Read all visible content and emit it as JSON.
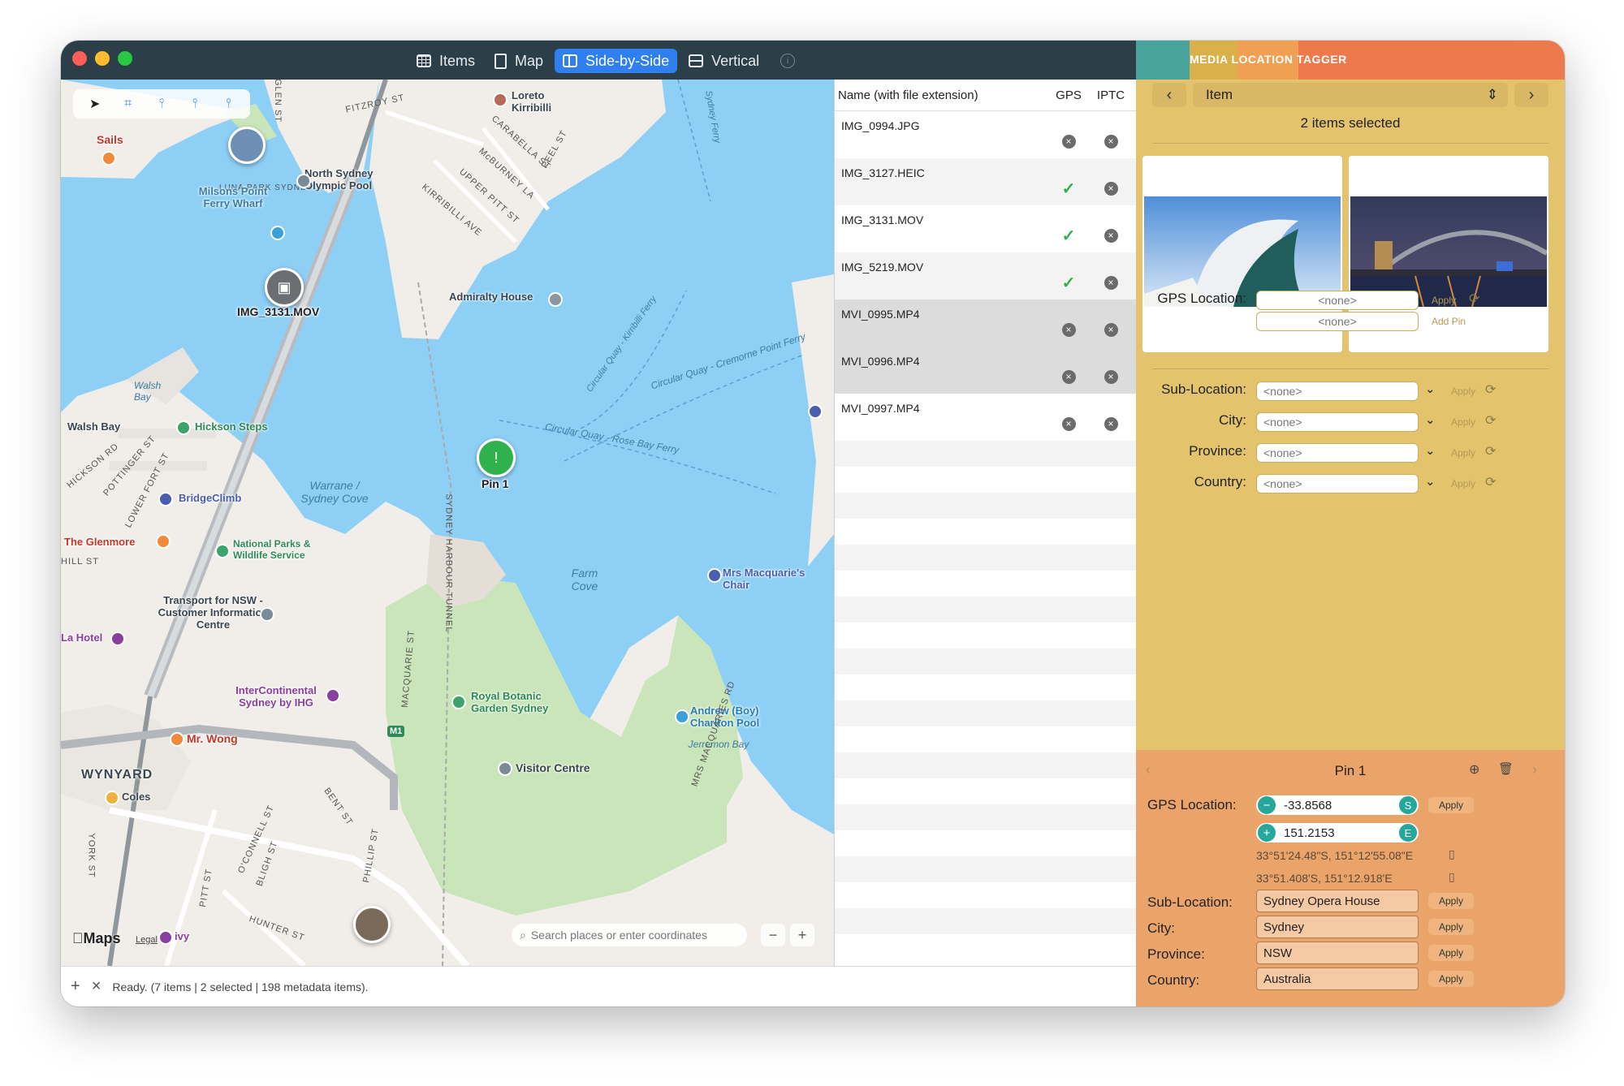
{
  "titlebar": {
    "segments": [
      {
        "label": "Items",
        "icon": "table-icon"
      },
      {
        "label": "Map",
        "icon": "document-icon"
      },
      {
        "label": "Side-by-Side",
        "icon": "split-columns-icon"
      },
      {
        "label": "Vertical",
        "icon": "split-rows-icon"
      }
    ],
    "active_segment": "Side-by-Side",
    "info_glyph": "i"
  },
  "map": {
    "labels": [
      "Sails",
      "LUNA PARK SYDNEY",
      "Milsons Point Ferry Wharf",
      "North Sydney Olympic Pool",
      "Loreto Kirribilli",
      "Admiralty House",
      "IMG_3131.MOV",
      "Walsh Bay",
      "Hickson Steps",
      "BridgeClimb",
      "The Glenmore",
      "National Parks & Wildlife Service",
      "Warrane / Sydney Cove",
      "Pin 1",
      "Farm Cove",
      "Mrs Macquarie's Chair",
      "Transport for NSW - Customer Information Centre",
      "La Hotel",
      "InterContinental Sydney by IHG",
      "Royal Botanic Garden Sydney",
      "Andrew (Boy) Charlton Pool",
      "Mr. Wong",
      "WYNYARD",
      "Coles",
      "Visitor Centre",
      "Jerremon Bay",
      "Circular Quay - Rose Bay Ferry",
      "Circular Quay - Cremorne Point Ferry",
      "Circular Quay - Kirribilli Ferry",
      "Sydney Ferry",
      "SYDNEY HARBOUR TUNNEL",
      "M1",
      "FITZROY ST",
      "CARABELLA ST",
      "McBURNEY LA",
      "UPPER PITT ST",
      "KIRRIBILLI AVE",
      "PEEL ST",
      "HICKSON RD",
      "LOWER FORT ST",
      "POTTINGER ST",
      "MACQUARIE ST",
      "MRS MACQUARIES RD",
      "YORK ST",
      "PHILLIP ST",
      "BENT ST",
      "BLIGH ST",
      "O'CONNELL ST",
      "PITT ST",
      "HUNTER ST",
      "GLEN ST",
      "HILL ST",
      "ivy"
    ],
    "markers": {
      "video": "IMG_3131.MOV",
      "pin": "Pin 1"
    },
    "search_placeholder": "Search places or enter coordinates",
    "attribution": "Maps",
    "legal": "Legal",
    "zoom_out": "−",
    "zoom_in": "+"
  },
  "list": {
    "headers": {
      "name": "Name (with file extension)",
      "gps": "GPS",
      "iptc": "IPTC"
    },
    "rows": [
      {
        "name": "IMG_0994.JPG",
        "gps": false,
        "iptc": false,
        "selected": false
      },
      {
        "name": "IMG_3127.HEIC",
        "gps": true,
        "iptc": false,
        "selected": false
      },
      {
        "name": "IMG_3131.MOV",
        "gps": true,
        "iptc": false,
        "selected": false
      },
      {
        "name": "IMG_5219.MOV",
        "gps": true,
        "iptc": false,
        "selected": false
      },
      {
        "name": "MVI_0995.MP4",
        "gps": false,
        "iptc": false,
        "selected": true
      },
      {
        "name": "MVI_0996.MP4",
        "gps": false,
        "iptc": false,
        "selected": true
      },
      {
        "name": "MVI_0997.MP4",
        "gps": false,
        "iptc": false,
        "selected": false
      }
    ]
  },
  "status": {
    "add": "+",
    "remove": "×",
    "text": "Ready. (7 items | 2 selected | 198 metadata items)."
  },
  "panel": {
    "banner": "MEDIA LOCATION TAGGER",
    "banner_colors": [
      "#47a39b",
      "#d9b04a",
      "#f0a052",
      "#ec7a4c"
    ],
    "nav": {
      "prev": "‹",
      "next": "›",
      "selector": "Item"
    },
    "selection_text": "2 items selected",
    "gps": {
      "label": "GPS Location:",
      "lat": "<none>",
      "lon": "<none>",
      "apply": "Apply",
      "add_pin": "Add Pin"
    },
    "iptc": [
      {
        "label": "Sub-Location:",
        "value": "<none>",
        "apply": "Apply"
      },
      {
        "label": "City:",
        "value": "<none>",
        "apply": "Apply"
      },
      {
        "label": "Province:",
        "value": "<none>",
        "apply": "Apply"
      },
      {
        "label": "Country:",
        "value": "<none>",
        "apply": "Apply"
      }
    ]
  },
  "pin": {
    "title": "Pin 1",
    "gps_label": "GPS Location:",
    "lat": {
      "sign": "−",
      "value": "-33.8568",
      "hemisphere": "S"
    },
    "lon": {
      "sign": "+",
      "value": "151.2153",
      "hemisphere": "E"
    },
    "apply": "Apply",
    "dms": "33°51'24.48\"S, 151°12'55.08\"E",
    "dm": "33°51.408'S, 151°12.918'E",
    "fields": [
      {
        "label": "Sub-Location:",
        "value": "Sydney Opera House",
        "apply": "Apply"
      },
      {
        "label": "City:",
        "value": "Sydney",
        "apply": "Apply"
      },
      {
        "label": "Province:",
        "value": "NSW",
        "apply": "Apply"
      },
      {
        "label": "Country:",
        "value": "Australia",
        "apply": "Apply"
      }
    ]
  }
}
